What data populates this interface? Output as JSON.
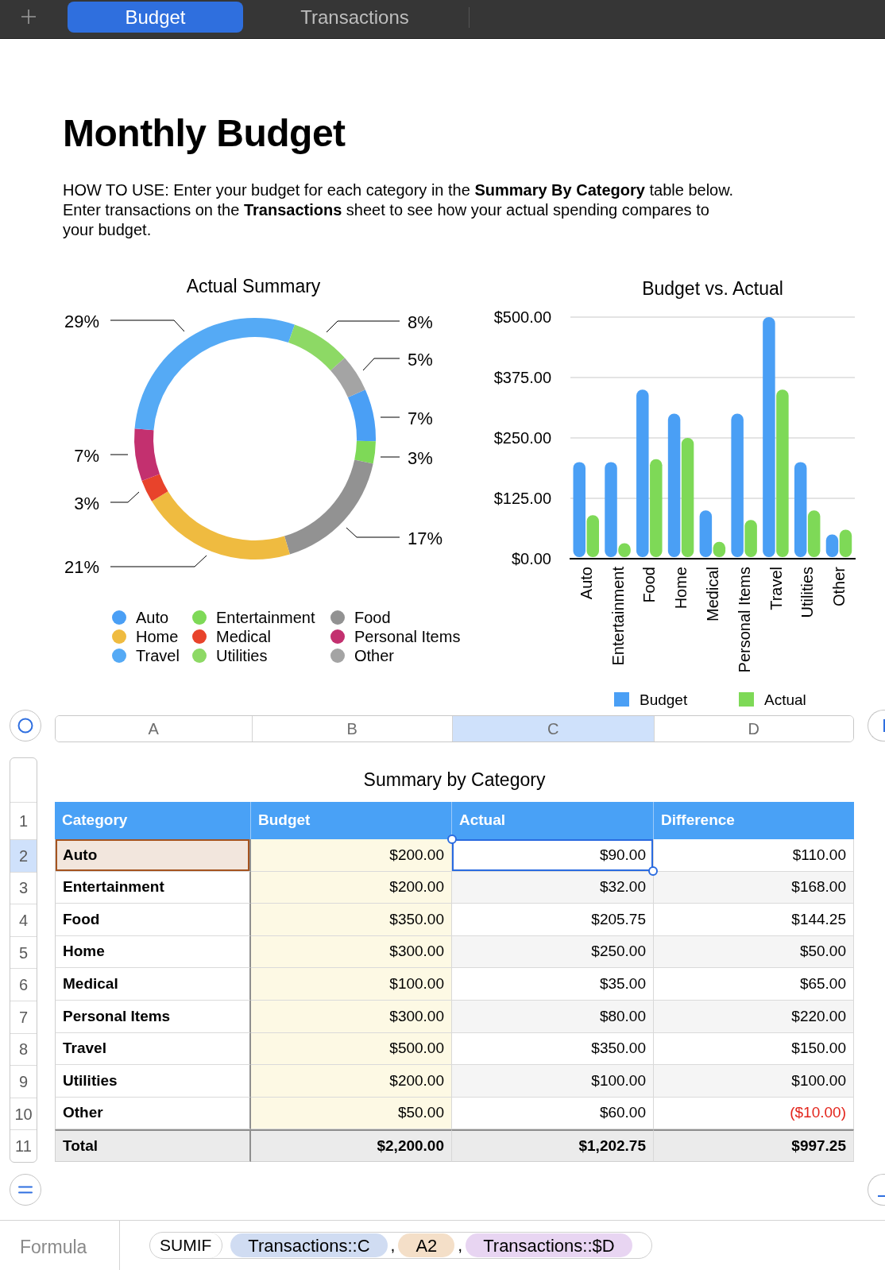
{
  "tab_bar": {
    "tabs": [
      {
        "label": "Budget",
        "selected": true
      },
      {
        "label": "Transactions",
        "selected": false
      }
    ]
  },
  "page": {
    "title": "Monthly Budget",
    "instructions": [
      "HOW TO USE: Enter your budget for each category in the **Summary By Category** table below.",
      "Enter transactions on the **Transactions** sheet to see how your actual spending compares to your budget."
    ]
  },
  "pie_chart": {
    "chart_data": {
      "type": "donut",
      "title": "Actual Summary",
      "values": [
        7,
        3,
        17,
        21,
        3,
        7,
        29,
        8,
        5
      ],
      "value_labels": [
        "7%",
        "3%",
        "17%",
        "21%",
        "3%",
        "7%",
        "29%",
        "8%",
        "5%"
      ]
    },
    "legend": [
      {
        "label": "Auto",
        "color": "#4a9ff5"
      },
      {
        "label": "Entertainment",
        "color": "#7ed957"
      },
      {
        "label": "Food",
        "color": "#929292"
      },
      {
        "label": "Home",
        "color": "#efbb40"
      },
      {
        "label": "Medical",
        "color": "#e8432b"
      },
      {
        "label": "Personal Items",
        "color": "#c3306f"
      },
      {
        "label": "Travel",
        "color": "#55aaf5"
      },
      {
        "label": "Utilities",
        "color": "#8dd965"
      },
      {
        "label": "Other",
        "color": "#a4a4a4"
      }
    ]
  },
  "bar_chart": {
    "chart_data": {
      "type": "bar",
      "title": "Budget vs. Actual",
      "categories": [
        "Auto",
        "Entertainment",
        "Food",
        "Home",
        "Medical",
        "Personal Items",
        "Travel",
        "Utilities",
        "Other"
      ],
      "series": [
        {
          "name": "Budget",
          "color": "#4a9ff5",
          "values": [
            200,
            200,
            350,
            300,
            100,
            300,
            500,
            200,
            50
          ]
        },
        {
          "name": "Actual",
          "color": "#7ed957",
          "values": [
            90,
            32,
            206,
            250,
            35,
            80,
            350,
            100,
            60
          ]
        }
      ],
      "ylim": [
        0,
        500
      ],
      "yticks": [
        {
          "value": 0,
          "label": "$0.00"
        },
        {
          "value": 125,
          "label": "$125.00"
        },
        {
          "value": 250,
          "label": "$250.00"
        },
        {
          "value": 375,
          "label": "$375.00"
        },
        {
          "value": 500,
          "label": "$500.00"
        }
      ],
      "grid": true,
      "legend": "bottom"
    }
  },
  "table": {
    "column_headers": [
      {
        "label": "A",
        "selected": false
      },
      {
        "label": "B",
        "selected": false
      },
      {
        "label": "C",
        "selected": true
      },
      {
        "label": "D",
        "selected": false
      }
    ],
    "row_headers": [
      {
        "label": "1",
        "selected": false
      },
      {
        "label": "2",
        "selected": true
      },
      {
        "label": "3",
        "selected": false
      },
      {
        "label": "4",
        "selected": false
      },
      {
        "label": "5",
        "selected": false
      },
      {
        "label": "6",
        "selected": false
      },
      {
        "label": "7",
        "selected": false
      },
      {
        "label": "8",
        "selected": false
      },
      {
        "label": "9",
        "selected": false
      },
      {
        "label": "10",
        "selected": false
      },
      {
        "label": "11",
        "selected": false
      }
    ],
    "title": "Summary by Category",
    "columns": [
      "Category",
      "Budget",
      "Actual",
      "Difference"
    ],
    "rows": [
      {
        "kind": "data",
        "cells": [
          "Auto",
          "$200.00",
          "$90.00",
          "$110.00"
        ],
        "referenced": true,
        "negative": false
      },
      {
        "kind": "data",
        "cells": [
          "Entertainment",
          "$200.00",
          "$32.00",
          "$168.00"
        ],
        "referenced": false,
        "negative": false
      },
      {
        "kind": "data",
        "cells": [
          "Food",
          "$350.00",
          "$205.75",
          "$144.25"
        ],
        "referenced": false,
        "negative": false
      },
      {
        "kind": "data",
        "cells": [
          "Home",
          "$300.00",
          "$250.00",
          "$50.00"
        ],
        "referenced": false,
        "negative": false
      },
      {
        "kind": "data",
        "cells": [
          "Medical",
          "$100.00",
          "$35.00",
          "$65.00"
        ],
        "referenced": false,
        "negative": false
      },
      {
        "kind": "data",
        "cells": [
          "Personal Items",
          "$300.00",
          "$80.00",
          "$220.00"
        ],
        "referenced": false,
        "negative": false
      },
      {
        "kind": "data",
        "cells": [
          "Travel",
          "$500.00",
          "$350.00",
          "$150.00"
        ],
        "referenced": false,
        "negative": false
      },
      {
        "kind": "data",
        "cells": [
          "Utilities",
          "$200.00",
          "$100.00",
          "$100.00"
        ],
        "referenced": false,
        "negative": false
      },
      {
        "kind": "data",
        "cells": [
          "Other",
          "$50.00",
          "$60.00",
          "($10.00)"
        ],
        "referenced": false,
        "negative": true
      },
      {
        "kind": "total",
        "cells": [
          "Total",
          "$2,200.00",
          "$1,202.75",
          "$997.25"
        ],
        "referenced": false,
        "negative": false
      }
    ]
  },
  "formula_bar": {
    "label": "Formula",
    "function": "SUMIF",
    "tokens": [
      {
        "kind": "argument",
        "text": "Transactions::C",
        "color": "#d0dcf2"
      },
      {
        "kind": "separator",
        "text": ","
      },
      {
        "kind": "argument",
        "text": "A2",
        "color": "#f4dfc8"
      },
      {
        "kind": "separator",
        "text": ","
      },
      {
        "kind": "argument",
        "text": "Transactions::$D",
        "color": "#e8d5f2"
      }
    ]
  }
}
